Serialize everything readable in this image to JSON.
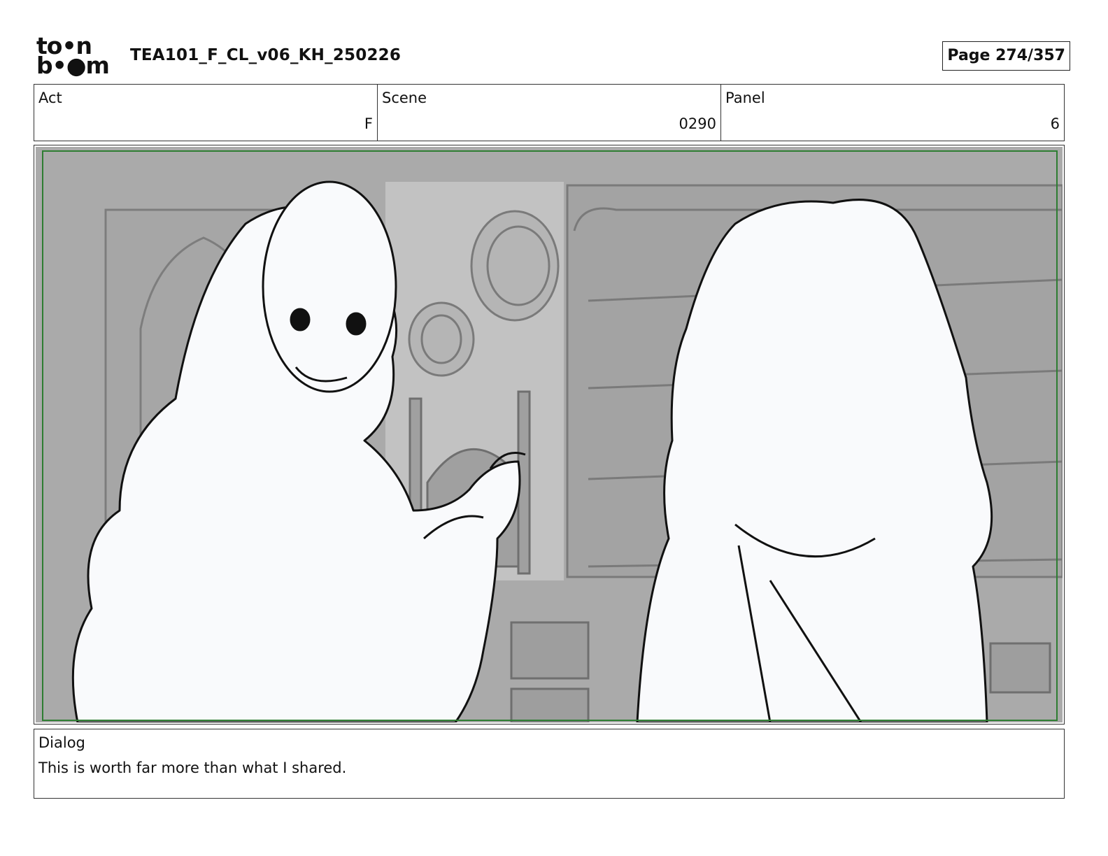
{
  "header": {
    "logo_line1": "to•n",
    "logo_line2": "b•●m",
    "doc_title": "TEA101_F_CL_v06_KH_250226",
    "page_label": "Page 274/357"
  },
  "meta": {
    "act_label": "Act",
    "act_value": "F",
    "scene_label": "Scene",
    "scene_value": "0290",
    "panel_label": "Panel",
    "panel_value": "6"
  },
  "dialog": {
    "label": "Dialog",
    "text": "This is worth far more than what I shared."
  },
  "colors": {
    "safe_frame": "#2e7d32",
    "background_gray": "#a9a9a9",
    "character_fill": "#f9fafc"
  }
}
